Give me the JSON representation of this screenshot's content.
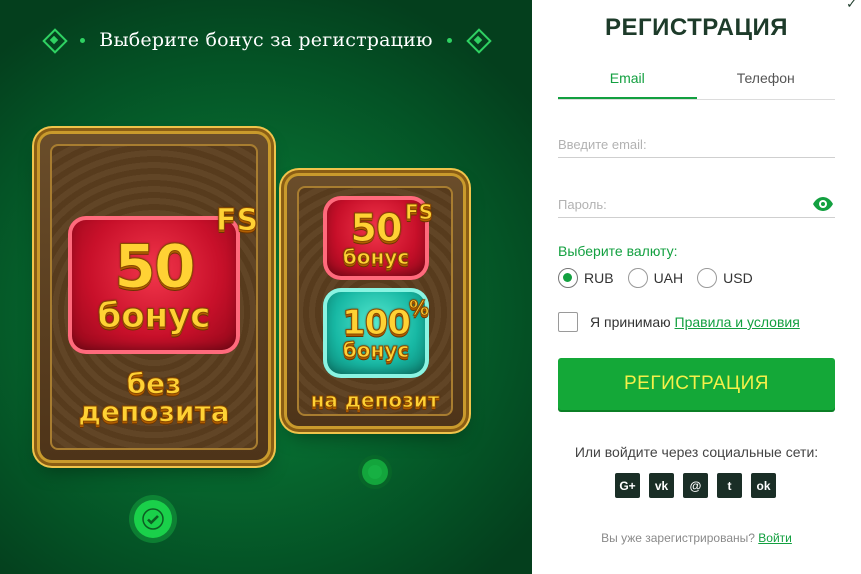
{
  "promo": {
    "title": "Выберите бонус за регистрацию",
    "card1": {
      "amount": "50",
      "fs": "FS",
      "bonus": "бонус",
      "caption_line1": "без",
      "caption_line2": "депозита"
    },
    "card2": {
      "amount": "50",
      "fs": "FS",
      "bonus": "бонус",
      "percent_amount": "100",
      "percent_sign": "%",
      "percent_bonus": "бонус",
      "caption": "на депозит"
    }
  },
  "registration": {
    "title": "РЕГИСТРАЦИЯ",
    "tabs": [
      {
        "label": "Email",
        "active": true
      },
      {
        "label": "Телефон",
        "active": false
      }
    ],
    "email_placeholder": "Введите email:",
    "password_placeholder": "Пароль:",
    "currency_label": "Выберите валюту:",
    "currencies": [
      {
        "code": "RUB",
        "selected": true
      },
      {
        "code": "UAH",
        "selected": false
      },
      {
        "code": "USD",
        "selected": false
      }
    ],
    "agree_text": "Я принимаю",
    "agree_link": "Правила и условия",
    "submit_label": "РЕГИСТРАЦИЯ",
    "social_label": "Или войдите через социальные сети:",
    "socials": [
      {
        "name": "google-plus",
        "glyph": "G+"
      },
      {
        "name": "vk",
        "glyph": "vk"
      },
      {
        "name": "mail",
        "glyph": "@"
      },
      {
        "name": "twitter",
        "glyph": "t"
      },
      {
        "name": "odnoklassniki",
        "glyph": "ok"
      }
    ],
    "already_text": "Вы уже зарегистрированы?",
    "login_link": "Войти"
  },
  "colors": {
    "accent": "#13a040",
    "button_text": "#f5f04a",
    "background": "#076b30"
  }
}
